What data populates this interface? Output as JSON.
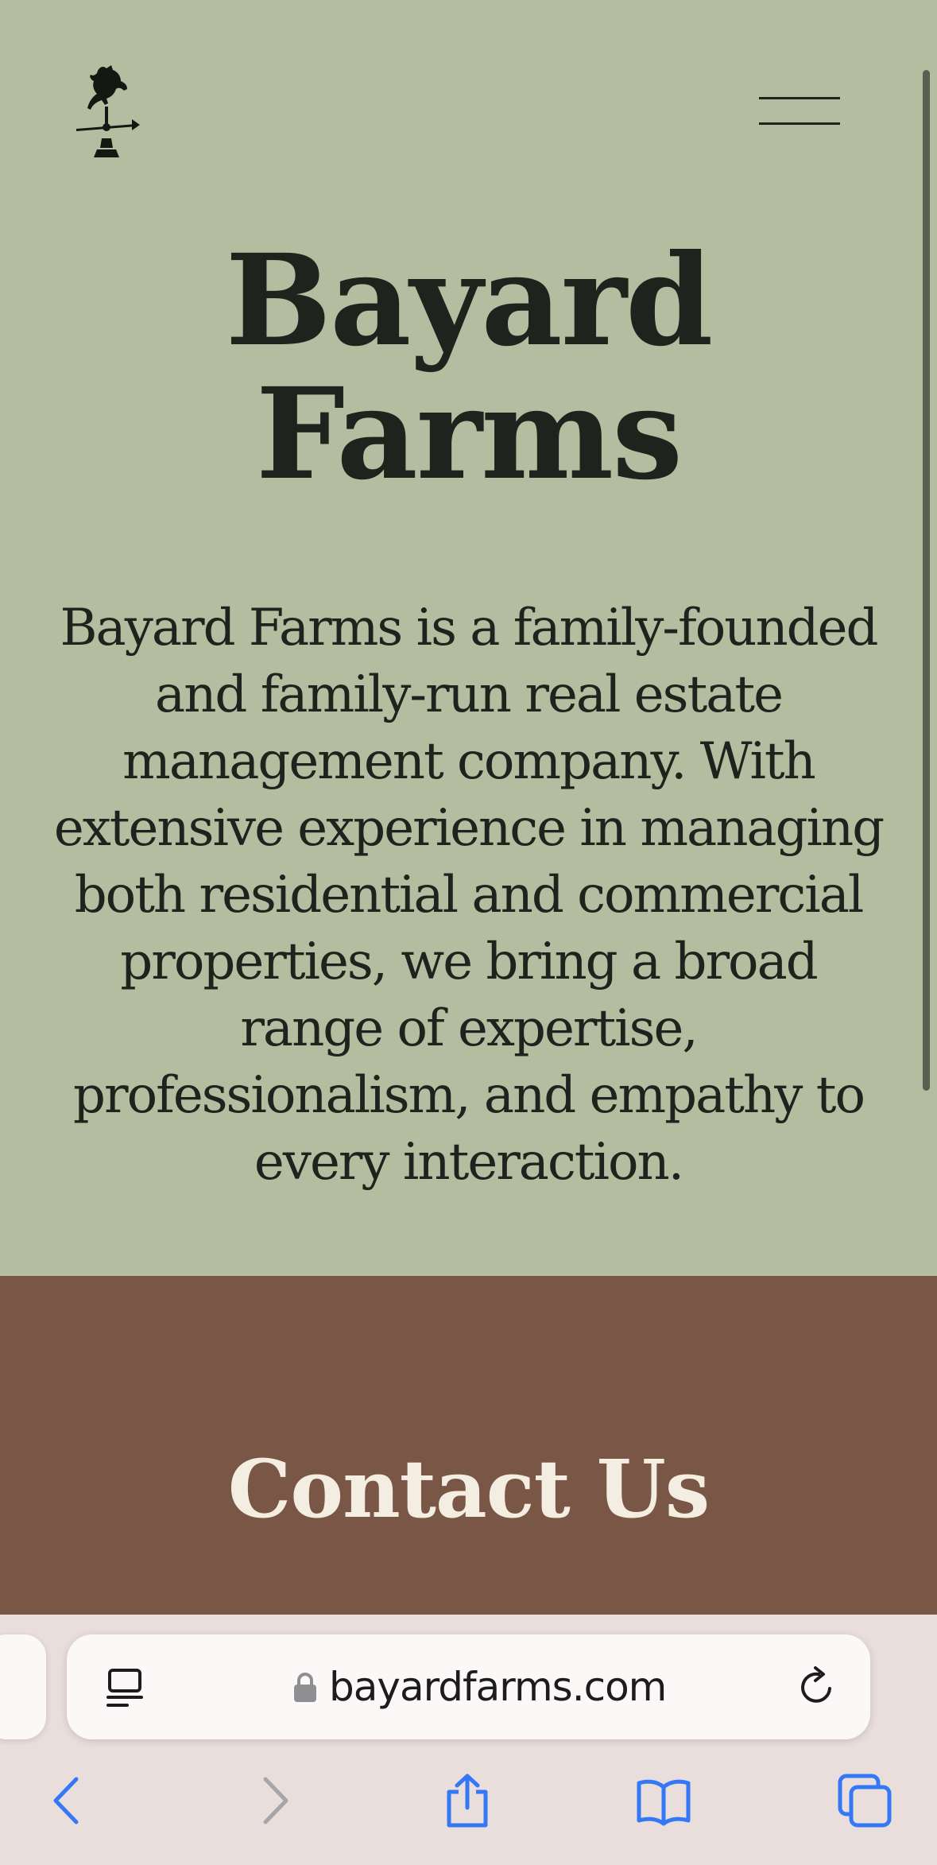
{
  "header": {
    "logo_icon": "horse-weathervane-icon",
    "menu_icon": "hamburger-menu-icon"
  },
  "hero": {
    "title_line1": "Bayard",
    "title_line2": "Farms",
    "intro": "Bayard Farms is a family-founded and family-run real estate management company. With extensive experience in managing both residential and commercial properties, we bring a broad range of expertise, professionalism, and empathy to every interaction."
  },
  "contact": {
    "title": "Contact Us"
  },
  "browser": {
    "url": "bayardfarms.com",
    "reader_icon": "reader-mode-icon",
    "lock_icon": "lock-icon",
    "reload_icon": "reload-icon",
    "nav_icons": [
      "back-arrow-icon",
      "forward-arrow-icon",
      "share-icon",
      "bookmarks-icon",
      "tabs-icon"
    ]
  },
  "colors": {
    "hero_bg": "#b6bc9f",
    "text_dark": "#1e231d",
    "contact_bg": "#7a5646",
    "contact_text": "#f4eee2",
    "toolbar_bg": "#e9dedc",
    "accent_blue": "#3478f6"
  }
}
